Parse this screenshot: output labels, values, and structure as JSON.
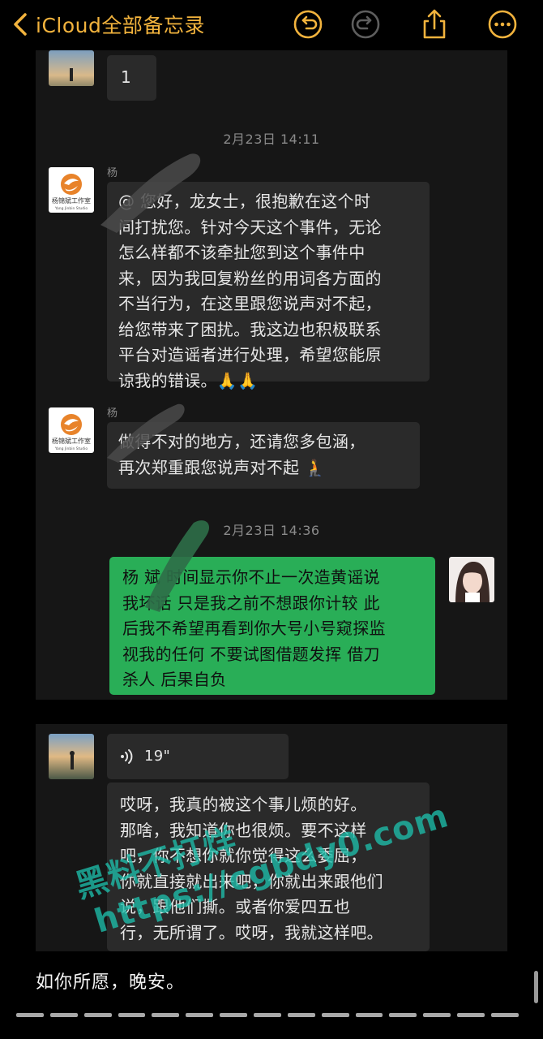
{
  "navbar": {
    "back_label": "iCloud全部备忘录",
    "icons": [
      "undo-icon",
      "redo-icon",
      "share-icon",
      "more-icon"
    ],
    "accent_color": "#f2b33d"
  },
  "screenshot_1": {
    "top_message": "1",
    "timestamp_1": "2月23日 14:11",
    "sender_1_name": "杨",
    "message_1_lines": [
      "@  您好，龙女士，很抱歉在这个时",
      "间打扰您。针对今天这个事件，无论",
      "怎么样都不该牵扯您到这个事件中",
      "来，因为我回复粉丝的用词各方面的",
      "不当行为，在这里跟您说声对不起，",
      "给您带来了困扰。我这边也积极联系",
      "平台对造谣者进行处理，希望您能原",
      "谅我的错误。🙏🙏"
    ],
    "sender_2_name": "杨",
    "message_2_lines": [
      "  做得不对的地方，还请您多包涵，",
      "再次郑重跟您说声对不起 🧎"
    ],
    "timestamp_2": "2月23日 14:36",
    "reply_lines": [
      "杨   斌 时间显示你不止一次造黄谣说",
      "我坏话 只是我之前不想跟你计较 此",
      "后我不希望再看到你大号小号窥探监",
      "视我的任何 不要试图借题发挥 借刀",
      "杀人 后果自负"
    ],
    "logo_text": "杨锦斌工作室",
    "logo_subtext": "Yang Jinbin Studio"
  },
  "screenshot_2": {
    "voice_duration": "19\"",
    "message_lines": [
      "哎呀，我真的被这个事儿烦的好。",
      "那啥，我知道你也很烦。要不这样",
      "吧，你不想你就你觉得这么委屈，",
      "你就直接就出来吧，你就出来跟他们",
      "说，跟他们撕。或者你爱四五也",
      "行，无所谓了。哎呀，我就这样吧。"
    ]
  },
  "note_text": "如你所愿，晚安。",
  "watermark": {
    "line_1": "黑料不打烊",
    "line_2": "https://cgbdy0.com"
  },
  "colors": {
    "bubble_green": "#29ae57",
    "bubble_gray": "#2a2a2a",
    "panel_bg": "#161616",
    "watermark": "#1ebeaa"
  }
}
